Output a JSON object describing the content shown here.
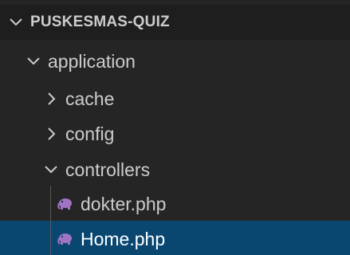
{
  "explorer": {
    "section_title": "PUSKESMAS-QUIZ",
    "tree": [
      {
        "label": "application",
        "kind": "folder",
        "expanded": true,
        "depth": 1
      },
      {
        "label": "cache",
        "kind": "folder",
        "expanded": false,
        "depth": 2
      },
      {
        "label": "config",
        "kind": "folder",
        "expanded": false,
        "depth": 2
      },
      {
        "label": "controllers",
        "kind": "folder",
        "expanded": true,
        "depth": 2
      },
      {
        "label": "dokter.php",
        "kind": "php-file",
        "depth": 3,
        "selected": false
      },
      {
        "label": "Home.php",
        "kind": "php-file",
        "depth": 3,
        "selected": true
      }
    ]
  },
  "colors": {
    "background": "#252526",
    "header_background": "#1e1e1e",
    "selected_background": "#094771",
    "text": "#cccccc",
    "php_icon": "#a074c4"
  },
  "icons": {
    "expanded": "chevron-down-icon",
    "collapsed": "chevron-right-icon",
    "php_file": "php-elephant-icon"
  }
}
